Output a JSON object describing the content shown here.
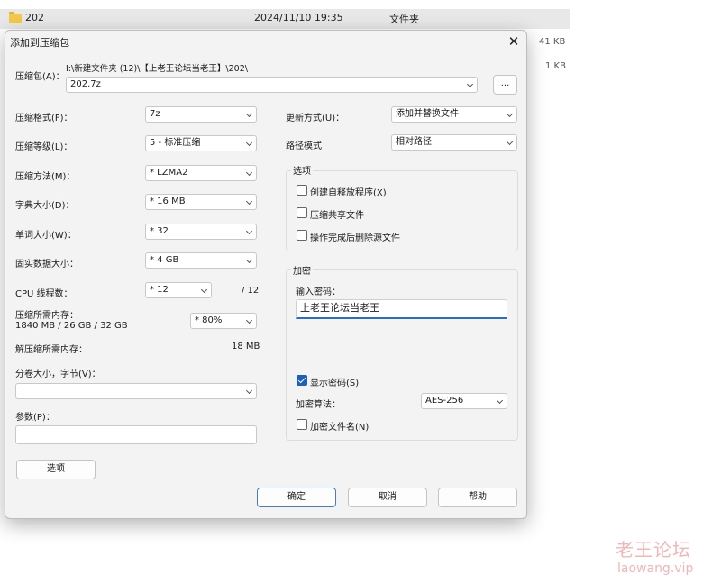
{
  "background": {
    "folder_name": "202",
    "modified": "2024/11/10 19:35",
    "type": "文件夹",
    "size1": "41 KB",
    "size2": "1 KB"
  },
  "dialog": {
    "title": "添加到压缩包",
    "close_glyph": "✕",
    "archive_label": "压缩包(A)：",
    "archive_path": "I:\\新建文件夹 (12)\\【上老王论坛当老王】\\202\\",
    "archive_name": "202.7z",
    "browse_label": "...",
    "format_label": "压缩格式(F)：",
    "format_value": "7z",
    "level_label": "压缩等级(L)：",
    "level_value": "5 - 标准压缩",
    "method_label": "压缩方法(M)：",
    "method_value": "* LZMA2",
    "dict_label": "字典大小(D)：",
    "dict_value": "* 16 MB",
    "word_label": "单词大小(W)：",
    "word_value": "* 32",
    "solid_label": "固实数据大小：",
    "solid_value": "* 4 GB",
    "cpu_label": "CPU 线程数：",
    "cpu_value": "* 12",
    "cpu_total": "/ 12",
    "mem_label": "压缩所需内存：",
    "mem_detail": "1840 MB / 26 GB / 32 GB",
    "mem_value": "* 80%",
    "decomp_label": "解压缩所需内存：",
    "decomp_value": "18 MB",
    "split_label": "分卷大小，字节(V)：",
    "split_value": "",
    "params_label": "参数(P)：",
    "params_value": "",
    "options_button": "选项",
    "update_label": "更新方式(U)：",
    "update_value": "添加并替换文件",
    "path_label": "路径模式",
    "path_value": "相对路径",
    "options_group": "选项",
    "opt_sfx": "创建自释放程序(X)",
    "opt_shared": "压缩共享文件",
    "opt_delete": "操作完成后删除源文件",
    "encrypt_group": "加密",
    "pw_label": "输入密码：",
    "pw_value": "上老王论坛当老王",
    "show_pw": "显示密码(S)",
    "enc_method_label": "加密算法：",
    "enc_method_value": "AES-256",
    "encrypt_names": "加密文件名(N)",
    "ok": "确定",
    "cancel": "取消",
    "help": "帮助"
  },
  "watermark": {
    "line1": "老王论坛",
    "line2": "laowang.vip"
  }
}
